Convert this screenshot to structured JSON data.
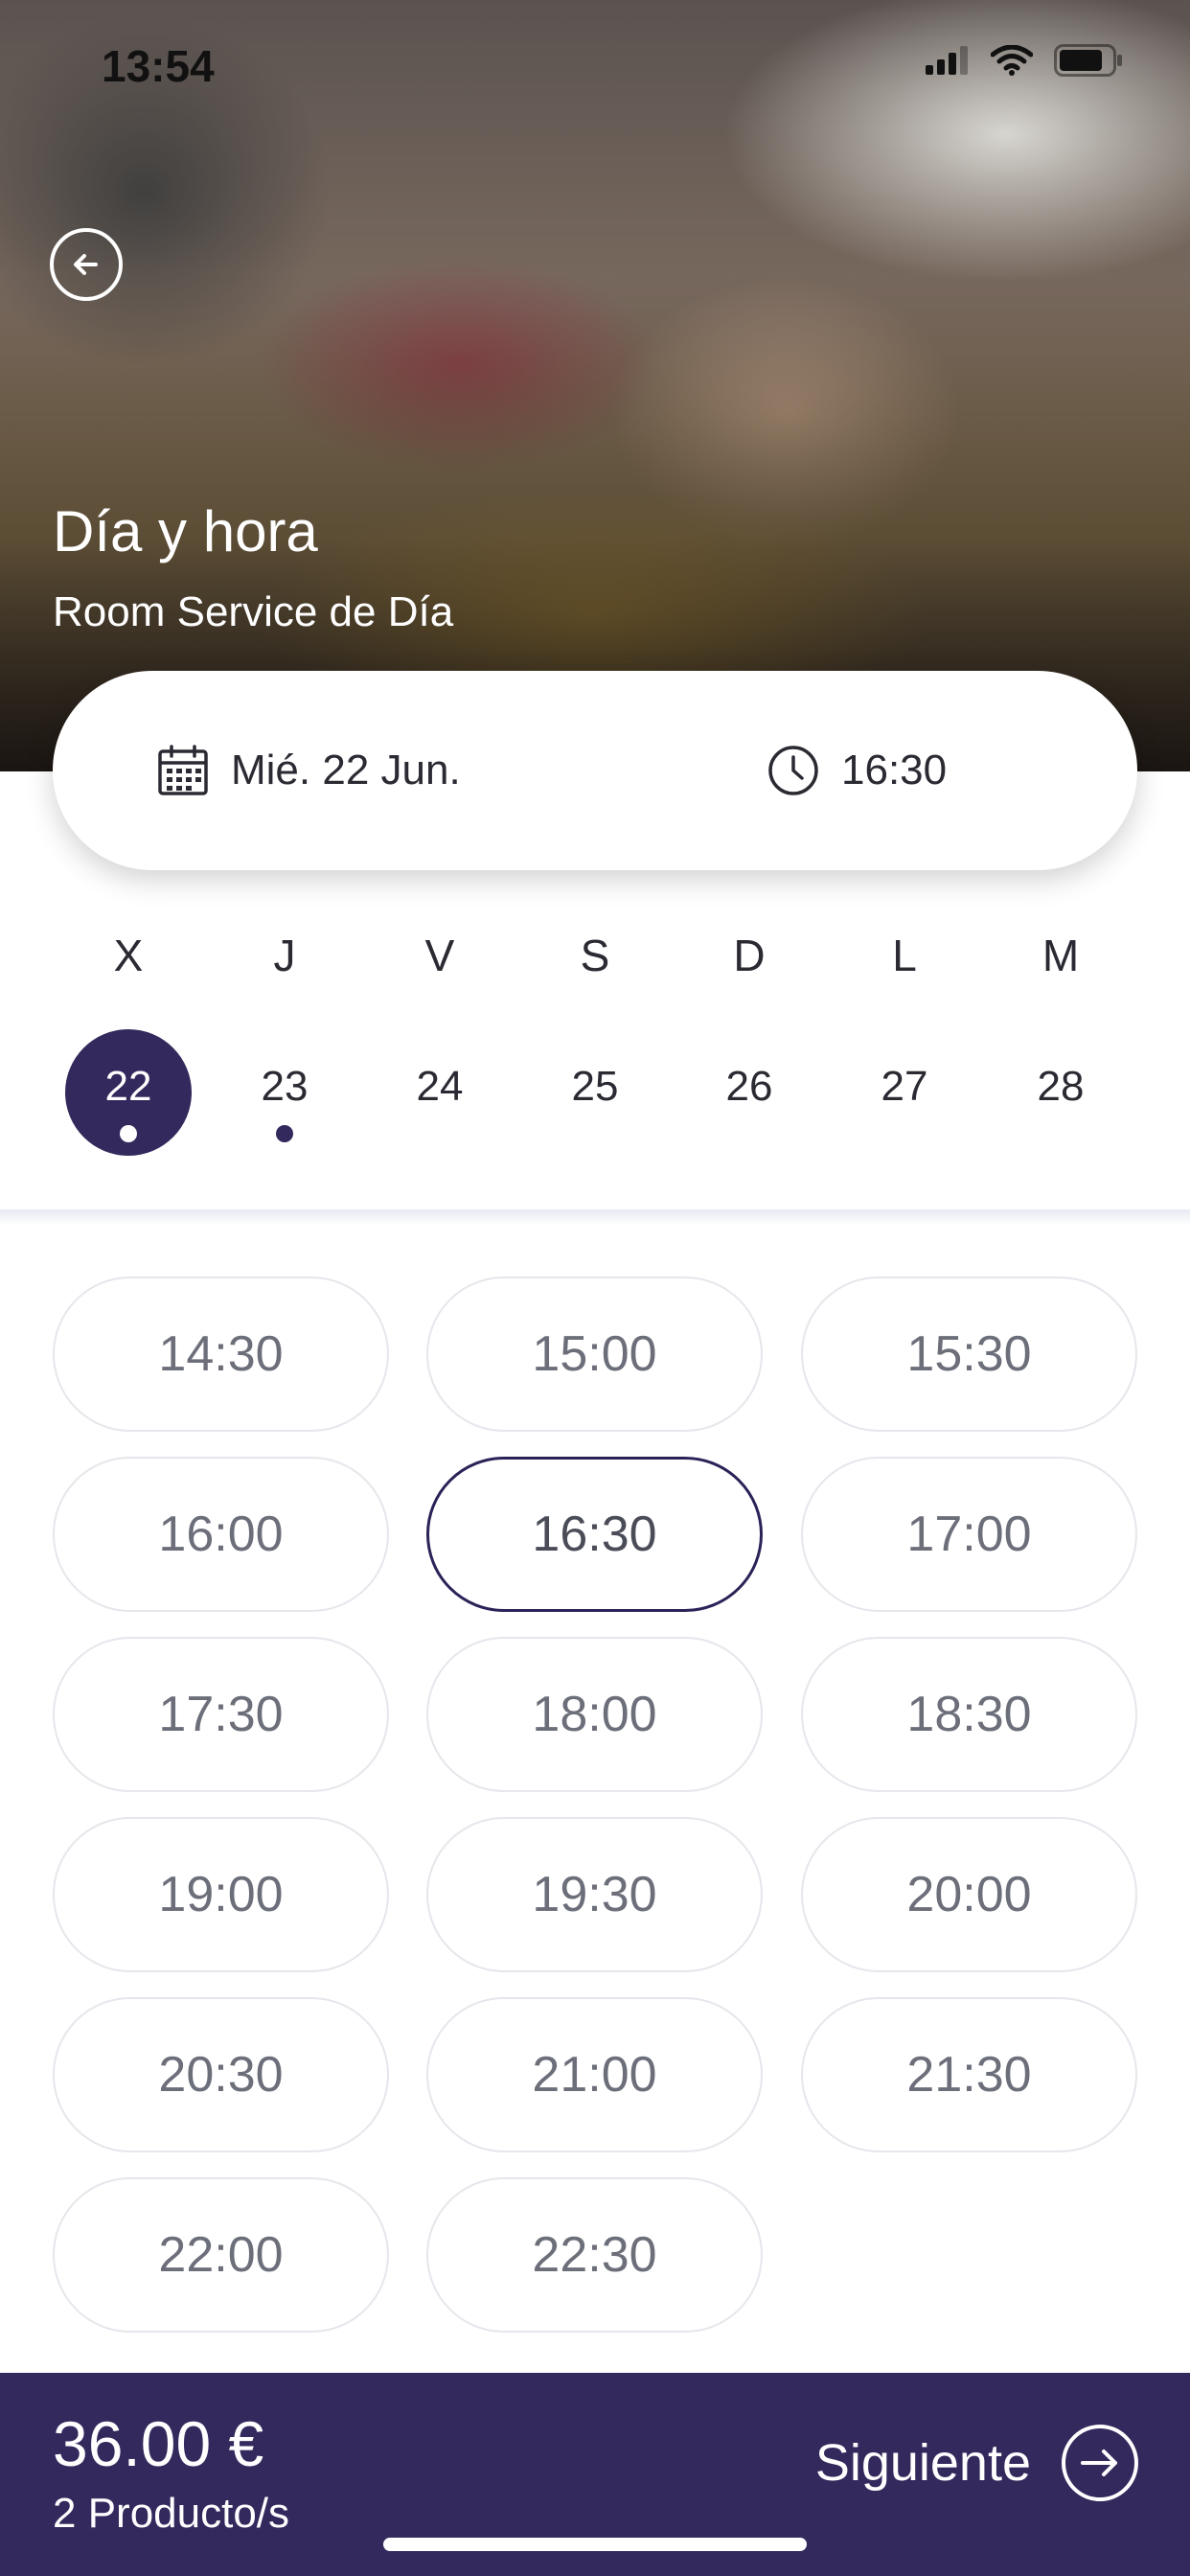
{
  "status_bar": {
    "time": "13:54"
  },
  "header": {
    "title": "Día y hora",
    "subtitle": "Room Service de Día"
  },
  "selector": {
    "date": "Mié. 22 Jun.",
    "time": "16:30"
  },
  "week": [
    {
      "letter": "X",
      "number": "22",
      "selected": true,
      "has_dot": true
    },
    {
      "letter": "J",
      "number": "23",
      "selected": false,
      "has_dot": true
    },
    {
      "letter": "V",
      "number": "24",
      "selected": false,
      "has_dot": false
    },
    {
      "letter": "S",
      "number": "25",
      "selected": false,
      "has_dot": false
    },
    {
      "letter": "D",
      "number": "26",
      "selected": false,
      "has_dot": false
    },
    {
      "letter": "L",
      "number": "27",
      "selected": false,
      "has_dot": false
    },
    {
      "letter": "M",
      "number": "28",
      "selected": false,
      "has_dot": false
    }
  ],
  "time_slots": [
    "14:30",
    "15:00",
    "15:30",
    "16:00",
    "16:30",
    "17:00",
    "17:30",
    "18:00",
    "18:30",
    "19:00",
    "19:30",
    "20:00",
    "20:30",
    "21:00",
    "21:30",
    "22:00",
    "22:30"
  ],
  "selected_slot": "16:30",
  "footer": {
    "price": "36.00 €",
    "products": "2 Producto/s",
    "next_label": "Siguiente"
  },
  "colors": {
    "accent": "#34295d",
    "slot_border": "#e6e6ec",
    "slot_text": "#6c6f7a"
  },
  "icons": {
    "back": "arrow-left-circle-icon",
    "calendar": "calendar-icon",
    "clock": "clock-icon",
    "next": "arrow-right-circle-icon"
  }
}
